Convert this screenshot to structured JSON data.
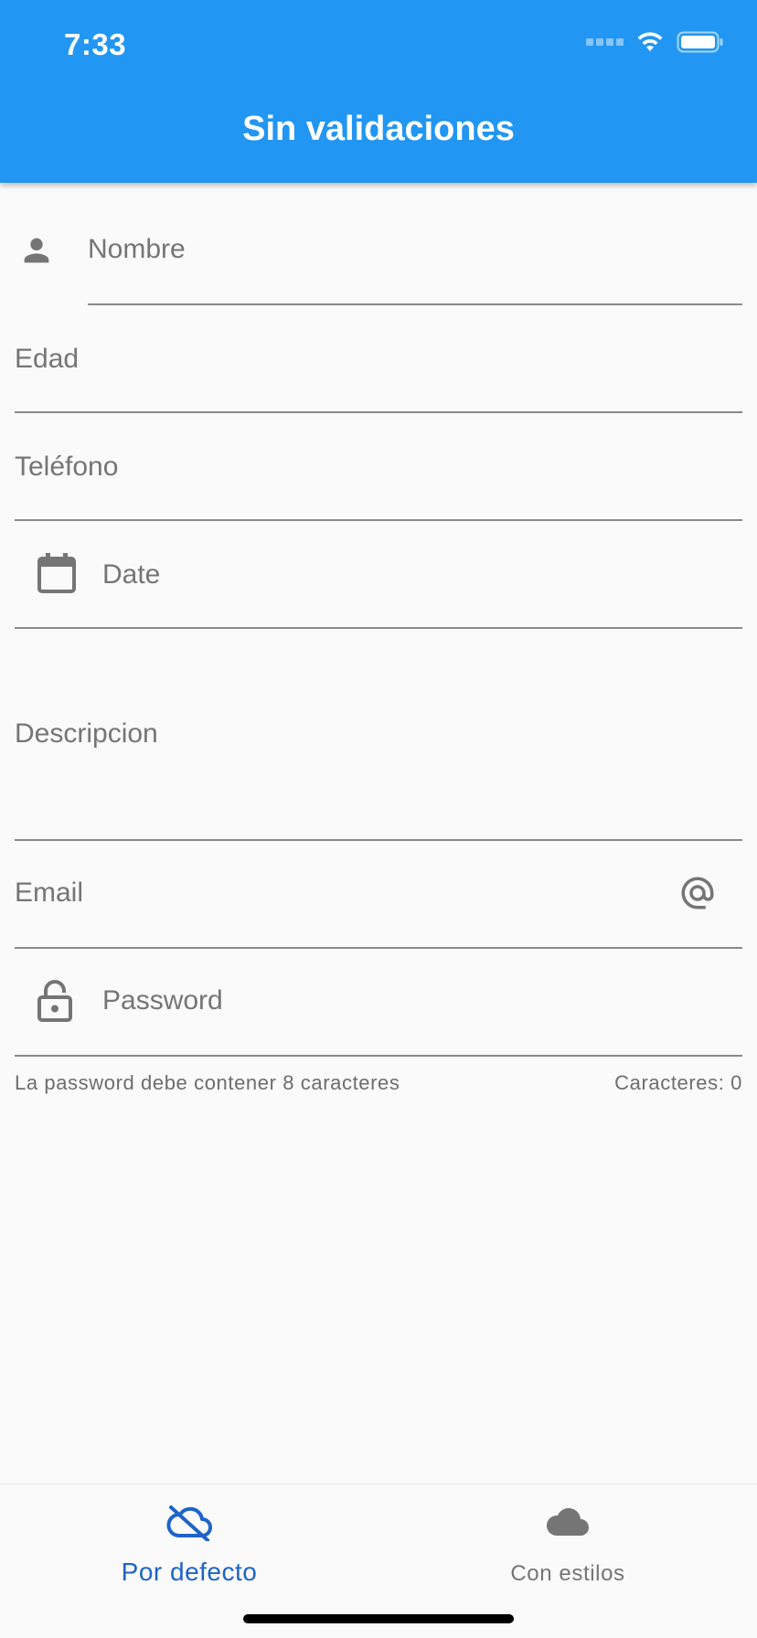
{
  "status_bar": {
    "time": "7:33"
  },
  "app_bar": {
    "title": "Sin validaciones",
    "color": "#2196f3"
  },
  "form": {
    "nombre": {
      "label": "Nombre",
      "icon": "person-icon"
    },
    "edad": {
      "label": "Edad"
    },
    "telefono": {
      "label": "Teléfono"
    },
    "date": {
      "label": "Date",
      "icon": "calendar-icon"
    },
    "descripcion": {
      "label": "Descripcion"
    },
    "email": {
      "label": "Email",
      "icon": "at-icon"
    },
    "password": {
      "label": "Password",
      "icon": "lock-icon",
      "helper": "La password debe contener 8 caracteres",
      "counter": "Caracteres: 0"
    }
  },
  "bottom_nav": {
    "items": [
      {
        "label": "Por defecto",
        "icon": "cloud-off-icon",
        "selected": true,
        "color": "#1e63c8"
      },
      {
        "label": "Con estilos",
        "icon": "cloud-icon",
        "selected": false,
        "color": "#757575"
      }
    ]
  }
}
